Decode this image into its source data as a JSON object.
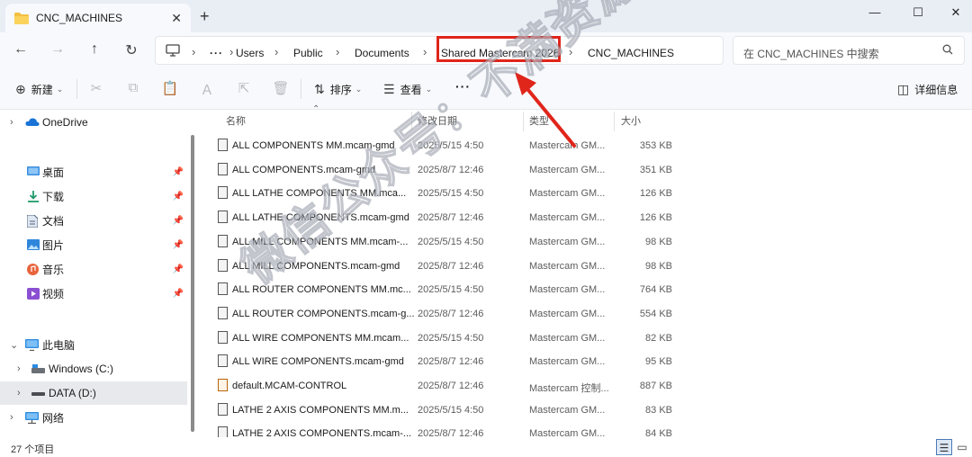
{
  "window": {
    "tab_title": "CNC_MACHINES",
    "tab_close": "✕",
    "new_tab": "+",
    "minimize": "—",
    "maximize": "☐",
    "close": "✕"
  },
  "nav": {
    "back": "←",
    "forward": "→",
    "up": "↑",
    "refresh": "↻"
  },
  "breadcrumb": {
    "items": [
      "Users",
      "Public",
      "Documents",
      "Shared Mastercam 2026",
      "CNC_MACHINES"
    ],
    "overflow": "···",
    "sep": "›"
  },
  "search": {
    "placeholder": "在 CNC_MACHINES 中搜索"
  },
  "toolbar": {
    "new_label": "新建",
    "sort_label": "排序",
    "view_label": "查看",
    "more": "···",
    "details_label": "详细信息"
  },
  "sidebar": {
    "items": [
      {
        "label": "OneDrive",
        "icon": "cloud-icon"
      },
      {
        "label": "桌面",
        "icon": "desktop-icon"
      },
      {
        "label": "下载",
        "icon": "download-icon"
      },
      {
        "label": "文档",
        "icon": "document-icon"
      },
      {
        "label": "图片",
        "icon": "picture-icon"
      },
      {
        "label": "音乐",
        "icon": "music-icon"
      },
      {
        "label": "视频",
        "icon": "video-icon"
      },
      {
        "label": "此电脑",
        "icon": "computer-icon"
      },
      {
        "label": "Windows (C:)",
        "icon": "drive-icon"
      },
      {
        "label": "DATA (D:)",
        "icon": "drive-icon"
      },
      {
        "label": "网络",
        "icon": "network-icon"
      }
    ]
  },
  "columns": {
    "name": "名称",
    "modified": "修改日期",
    "type": "类型",
    "size": "大小"
  },
  "files": [
    {
      "name": "ALL COMPONENTS MM.mcam-gmd",
      "modified": "2025/5/15 4:50",
      "type": "Mastercam GM...",
      "size": "353 KB"
    },
    {
      "name": "ALL COMPONENTS.mcam-gmd",
      "modified": "2025/8/7 12:46",
      "type": "Mastercam GM...",
      "size": "351 KB"
    },
    {
      "name": "ALL LATHE COMPONENTS MM.mca...",
      "modified": "2025/5/15 4:50",
      "type": "Mastercam GM...",
      "size": "126 KB"
    },
    {
      "name": "ALL LATHE COMPONENTS.mcam-gmd",
      "modified": "2025/8/7 12:46",
      "type": "Mastercam GM...",
      "size": "126 KB"
    },
    {
      "name": "ALL MILL COMPONENTS MM.mcam-...",
      "modified": "2025/5/15 4:50",
      "type": "Mastercam GM...",
      "size": "98 KB"
    },
    {
      "name": "ALL MILL COMPONENTS.mcam-gmd",
      "modified": "2025/8/7 12:46",
      "type": "Mastercam GM...",
      "size": "98 KB"
    },
    {
      "name": "ALL ROUTER COMPONENTS MM.mc...",
      "modified": "2025/5/15 4:50",
      "type": "Mastercam GM...",
      "size": "764 KB"
    },
    {
      "name": "ALL ROUTER COMPONENTS.mcam-g...",
      "modified": "2025/8/7 12:46",
      "type": "Mastercam GM...",
      "size": "554 KB"
    },
    {
      "name": "ALL WIRE COMPONENTS MM.mcam...",
      "modified": "2025/5/15 4:50",
      "type": "Mastercam GM...",
      "size": "82 KB"
    },
    {
      "name": "ALL WIRE COMPONENTS.mcam-gmd",
      "modified": "2025/8/7 12:46",
      "type": "Mastercam GM...",
      "size": "95 KB"
    },
    {
      "name": "default.MCAM-CONTROL",
      "modified": "2025/8/7 12:46",
      "type": "Mastercam 控制...",
      "size": "887 KB"
    },
    {
      "name": "LATHE 2 AXIS COMPONENTS MM.m...",
      "modified": "2025/5/15 4:50",
      "type": "Mastercam GM...",
      "size": "83 KB"
    },
    {
      "name": "LATHE 2 AXIS COMPONENTS.mcam-...",
      "modified": "2025/8/7 12:46",
      "type": "Mastercam GM...",
      "size": "84 KB"
    }
  ],
  "status": {
    "count": "27 个项目"
  },
  "annotation": {
    "highlight_color": "#e0251b",
    "watermark": "微信公众号：不满资源库"
  }
}
